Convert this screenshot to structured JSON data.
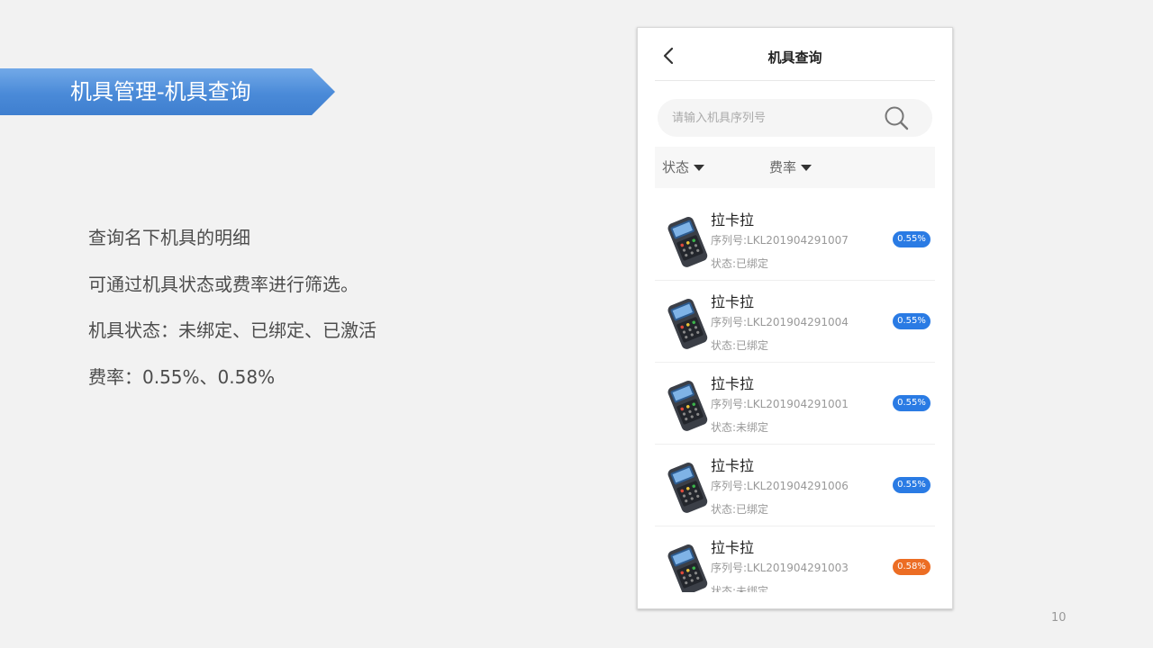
{
  "slide": {
    "title": "机具管理-机具查询",
    "desc_lines": [
      "查询名下机具的明细",
      "可通过机具状态或费率进行筛选。",
      "机具状态：未绑定、已绑定、已激活",
      "费率：0.55%、0.58%"
    ],
    "page_number": "10"
  },
  "phone": {
    "nav": {
      "title": "机具查询",
      "back_icon": "back-arrow-icon"
    },
    "search": {
      "placeholder": "请输入机具序列号",
      "value": "",
      "icon": "search-icon"
    },
    "filters": [
      {
        "label": "状态"
      },
      {
        "label": "费率"
      }
    ],
    "devices": [
      {
        "name": "拉卡拉",
        "serial": "序列号:LKL201904291007",
        "status": "状态:已绑定",
        "rate": "0.55%",
        "rate_color": "#2a7be4"
      },
      {
        "name": "拉卡拉",
        "serial": "序列号:LKL201904291004",
        "status": "状态:已绑定",
        "rate": "0.55%",
        "rate_color": "#2a7be4"
      },
      {
        "name": "拉卡拉",
        "serial": "序列号:LKL201904291001",
        "status": "状态:未绑定",
        "rate": "0.55%",
        "rate_color": "#2a7be4"
      },
      {
        "name": "拉卡拉",
        "serial": "序列号:LKL201904291006",
        "status": "状态:已绑定",
        "rate": "0.55%",
        "rate_color": "#2a7be4"
      },
      {
        "name": "拉卡拉",
        "serial": "序列号:LKL201904291003",
        "status": "状态:未绑定",
        "rate": "0.58%",
        "rate_color": "#ec6d24"
      }
    ]
  }
}
